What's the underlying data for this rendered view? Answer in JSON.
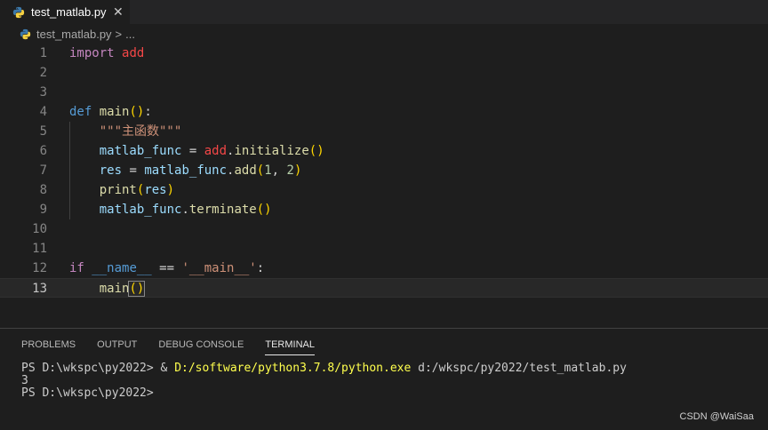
{
  "tab": {
    "filename": "test_matlab.py",
    "close": "✕"
  },
  "breadcrumb": {
    "file": "test_matlab.py",
    "separator": ">",
    "more": "..."
  },
  "editor": {
    "lines": [
      {
        "n": "1",
        "tokens": [
          [
            "kw",
            "import"
          ],
          [
            "",
            " "
          ],
          [
            "mod",
            "add"
          ]
        ]
      },
      {
        "n": "2",
        "tokens": []
      },
      {
        "n": "3",
        "tokens": []
      },
      {
        "n": "4",
        "tokens": [
          [
            "kw2",
            "def"
          ],
          [
            "",
            " "
          ],
          [
            "fn",
            "main"
          ],
          [
            "p1",
            "()"
          ],
          [
            "",
            ":"
          ]
        ]
      },
      {
        "n": "5",
        "tokens": [
          [
            "",
            "    "
          ],
          [
            "str",
            "\"\"\"主函数\"\"\""
          ]
        ]
      },
      {
        "n": "6",
        "tokens": [
          [
            "",
            "    "
          ],
          [
            "var",
            "matlab_func"
          ],
          [
            "",
            " = "
          ],
          [
            "mod",
            "add"
          ],
          [
            "",
            "."
          ],
          [
            "fn",
            "initialize"
          ],
          [
            "p1",
            "()"
          ]
        ]
      },
      {
        "n": "7",
        "tokens": [
          [
            "",
            "    "
          ],
          [
            "var",
            "res"
          ],
          [
            "",
            " = "
          ],
          [
            "var",
            "matlab_func"
          ],
          [
            "",
            "."
          ],
          [
            "fn",
            "add"
          ],
          [
            "p1",
            "("
          ],
          [
            "num",
            "1"
          ],
          [
            "",
            ", "
          ],
          [
            "num",
            "2"
          ],
          [
            "p1",
            ")"
          ]
        ]
      },
      {
        "n": "8",
        "tokens": [
          [
            "",
            "    "
          ],
          [
            "fn",
            "print"
          ],
          [
            "p1",
            "("
          ],
          [
            "var",
            "res"
          ],
          [
            "p1",
            ")"
          ]
        ]
      },
      {
        "n": "9",
        "tokens": [
          [
            "",
            "    "
          ],
          [
            "var",
            "matlab_func"
          ],
          [
            "",
            "."
          ],
          [
            "fn",
            "terminate"
          ],
          [
            "p1",
            "()"
          ]
        ]
      },
      {
        "n": "10",
        "tokens": []
      },
      {
        "n": "11",
        "tokens": []
      },
      {
        "n": "12",
        "tokens": [
          [
            "kw",
            "if"
          ],
          [
            "",
            " "
          ],
          [
            "dun",
            "__name__"
          ],
          [
            "",
            " == "
          ],
          [
            "str",
            "'__main__'"
          ],
          [
            "",
            ":"
          ]
        ]
      },
      {
        "n": "13",
        "tokens": [
          [
            "",
            "    "
          ],
          [
            "fn",
            "main"
          ],
          [
            "p1",
            "()"
          ]
        ]
      }
    ]
  },
  "panel": {
    "tabs": [
      "PROBLEMS",
      "OUTPUT",
      "DEBUG CONSOLE",
      "TERMINAL"
    ],
    "active_tab": "TERMINAL",
    "terminal": {
      "prompt1": "PS D:\\wkspc\\py2022> ",
      "amp": "& ",
      "exe": "D:/software/python3.7.8/python.exe",
      "arg": " d:/wkspc/py2022/test_matlab.py",
      "output": "3",
      "prompt2": "PS D:\\wkspc\\py2022>"
    }
  },
  "watermark": "CSDN @WaiSaa",
  "colors": {
    "accent": "#007acc",
    "background": "#1e1e1e"
  },
  "icons": {
    "file": "python-icon"
  }
}
